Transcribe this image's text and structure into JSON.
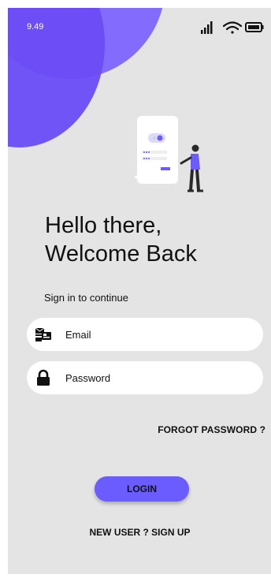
{
  "status_bar": {
    "time": "9.49"
  },
  "welcome": {
    "line1": "Hello there,",
    "line2": "Welcome Back"
  },
  "subtitle": "Sign in to continue",
  "email_field": {
    "placeholder": "Email",
    "icon": "email-card-icon"
  },
  "password_field": {
    "placeholder": "Password",
    "icon": "lock-icon"
  },
  "forgot_password": "FORGOT PASSWORD ?",
  "login_button": "LOGIN",
  "signup_link": "NEW USER ? SIGN UP",
  "colors": {
    "accent": "#6a5cff",
    "blob": "#7b61ff",
    "background": "#e4e4e4",
    "field": "#ffffff"
  }
}
